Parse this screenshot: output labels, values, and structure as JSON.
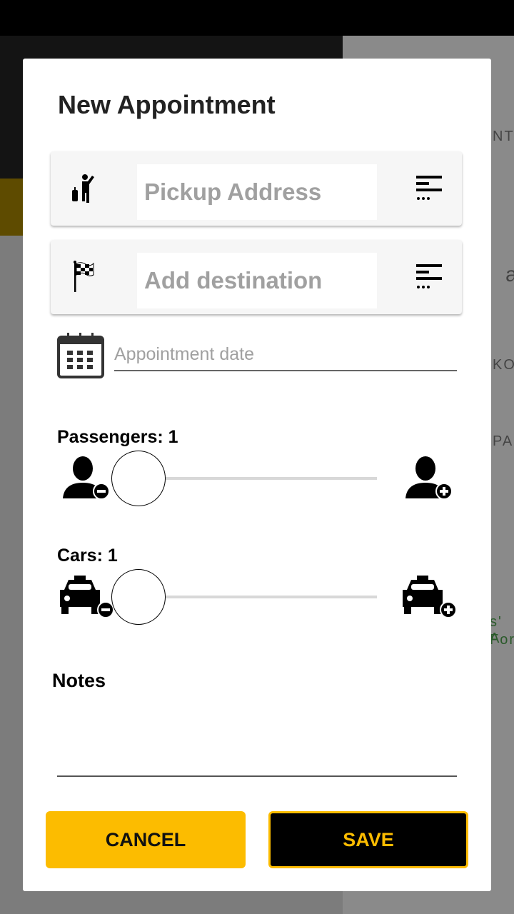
{
  "dialog": {
    "title": "New Appointment",
    "pickup": {
      "placeholder": "Pickup Address",
      "value": ""
    },
    "destination": {
      "placeholder": "Add destination",
      "value": ""
    },
    "appointment_date": {
      "placeholder": "Appointment date",
      "value": ""
    },
    "passengers": {
      "label": "Passengers: 1",
      "value": 1
    },
    "cars": {
      "label": "Cars: 1",
      "value": 1
    },
    "notes": {
      "label": "Notes",
      "value": ""
    },
    "cancel_label": "CANCEL",
    "save_label": "SAVE"
  },
  "background_map": {
    "labels": [
      "NT",
      "a",
      "KO",
      "PA",
      "s' A",
      "For"
    ]
  },
  "colors": {
    "accent": "#fcbc00",
    "dark": "#000000",
    "field_bg": "#f6f6f6"
  }
}
